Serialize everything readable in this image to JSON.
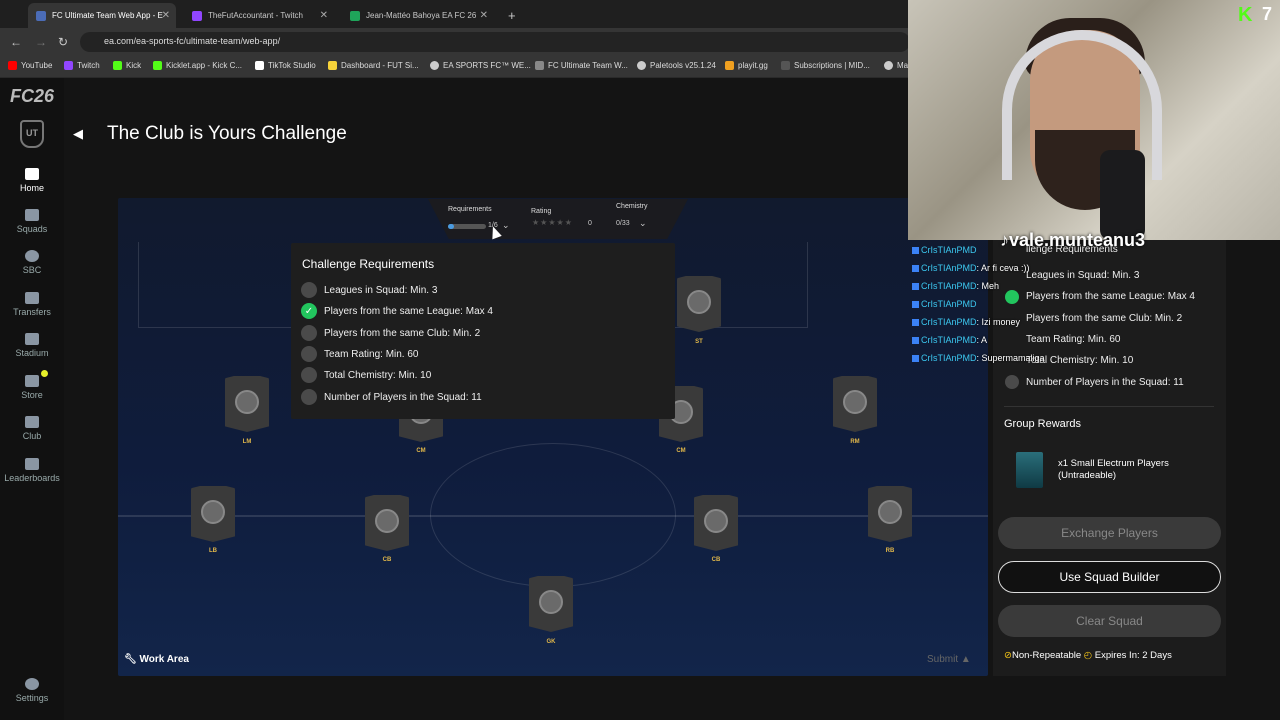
{
  "browser": {
    "tabs": [
      {
        "label": "FC Ultimate Team Web App - E"
      },
      {
        "label": "TheFutAccountant - Twitch"
      },
      {
        "label": "Jean-Mattéo Bahoya EA FC 26"
      }
    ],
    "url": "ea.com/ea-sports-fc/ultimate-team/web-app/",
    "bookmarks": [
      "YouTube",
      "Twitch",
      "Kick",
      "Kicklet.app - Kick C...",
      "TikTok Studio",
      "Dashboard - FUT Si...",
      "EA SPORTS FC™ WE...",
      "FC Ultimate Team W...",
      "Paletools v25.1.24",
      "playit.gg",
      "Subscriptions | MID...",
      "Ma"
    ]
  },
  "app": {
    "logo": "FC26",
    "ut_logo": "UT",
    "nav": [
      {
        "label": "Home"
      },
      {
        "label": "Squads"
      },
      {
        "label": "SBC"
      },
      {
        "label": "Transfers"
      },
      {
        "label": "Stadium"
      },
      {
        "label": "Store"
      },
      {
        "label": "Club"
      },
      {
        "label": "Leaderboards"
      }
    ],
    "settings": "Settings",
    "title": "The Club is Yours Challenge",
    "topbar": {
      "requirements_label": "Requirements",
      "requirements_value": "1/6",
      "requirements_progress": 0.17,
      "rating_label": "Rating",
      "rating_value": "0",
      "chemistry_label": "Chemistry",
      "chemistry_value": "0/33"
    },
    "positions": [
      "ST",
      "LM",
      "CM",
      "CM",
      "RM",
      "LB",
      "CB",
      "CB",
      "RB",
      "GK"
    ],
    "popup": {
      "title": "Challenge Requirements",
      "items": [
        {
          "text": "Leagues in Squad: Min. 3",
          "done": false
        },
        {
          "text": "Players from the same League: Max 4",
          "done": true
        },
        {
          "text": "Players from the same Club: Min. 2",
          "done": false
        },
        {
          "text": "Team Rating: Min. 60",
          "done": false
        },
        {
          "text": "Total Chemistry: Min. 10",
          "done": false
        },
        {
          "text": "Number of Players in the Squad: 11",
          "done": false
        }
      ]
    },
    "work_area": "Work Area",
    "submit": "Submit"
  },
  "right_panel": {
    "header": "llenge Requirements",
    "items": [
      "Leagues in Squad: Min. 3",
      "Players from the same League: Max 4",
      "Players from the same Club: Min. 2",
      "Team Rating: Min. 60",
      "Total Chemistry: Min. 10",
      "Number of Players in the Squad: 11"
    ],
    "group_rewards": "Group Rewards",
    "reward": "x1 Small Electrum Players (Untradeable)",
    "exchange": "Exchange Players",
    "builder": "Use Squad Builder",
    "clear": "Clear Squad",
    "non_repeatable": "Non-Repeatable",
    "expires": "Expires In: 2 Days"
  },
  "overlay": {
    "tiktok": "vale.munteanu3",
    "kick_count": "7",
    "chat": [
      {
        "user": "CrIsTIAnPMD",
        "msg": ""
      },
      {
        "user": "CrIsTIAnPMD",
        "msg": ": Ar fi ceva :))"
      },
      {
        "user": "CrIsTIAnPMD",
        "msg": ": Meh"
      },
      {
        "user": "CrIsTIAnPMD",
        "msg": ""
      },
      {
        "user": "CrIsTIAnPMD",
        "msg": ": Izi money"
      },
      {
        "user": "CrIsTIAnPMD",
        "msg": ": A"
      },
      {
        "user": "CrIsTIAnPMD",
        "msg": ": Supermamaliga"
      }
    ]
  },
  "colors": {
    "accent": "#22c55e",
    "brand_green": "#53fc18",
    "chat_user": "#3cc8f0",
    "position": "#e2b84a"
  }
}
